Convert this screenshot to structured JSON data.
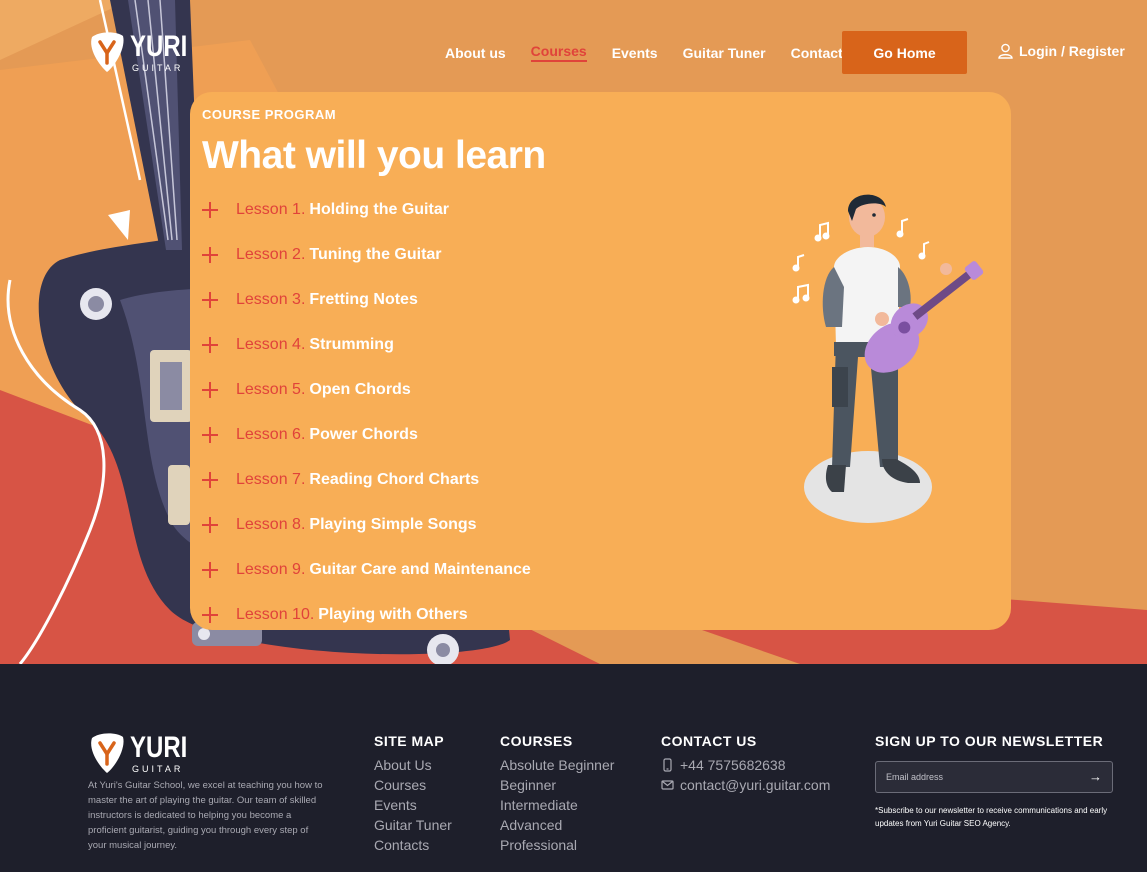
{
  "brand": {
    "name": "YURI",
    "tagline": "GUITAR"
  },
  "nav": {
    "items": [
      "About us",
      "Courses",
      "Events",
      "Guitar Tuner",
      "Contacts"
    ],
    "active": "Courses",
    "cta": "Go Home",
    "login": "Login / Register"
  },
  "program": {
    "eyebrow": "COURSE PROGRAM",
    "heading": "What will you learn",
    "lessons": [
      {
        "num": "Lesson 1.",
        "title": "Holding the Guitar"
      },
      {
        "num": "Lesson 2.",
        "title": "Tuning the Guitar"
      },
      {
        "num": "Lesson 3.",
        "title": "Fretting Notes"
      },
      {
        "num": "Lesson 4.",
        "title": "Strumming"
      },
      {
        "num": "Lesson 5.",
        "title": "Open Chords"
      },
      {
        "num": "Lesson 6.",
        "title": "Power Chords"
      },
      {
        "num": "Lesson 7.",
        "title": "Reading Chord Charts"
      },
      {
        "num": "Lesson 8.",
        "title": "Playing Simple Songs"
      },
      {
        "num": "Lesson 9.",
        "title": "Guitar Care and Maintenance"
      },
      {
        "num": "Lesson 10.",
        "title": "Playing with Others"
      }
    ]
  },
  "footer": {
    "about": "At Yuri's Guitar School, we excel at teaching you how to master the art of playing the guitar. Our team of skilled instructors is dedicated to helping you become a proficient guitarist, guiding you through every step of your musical journey.",
    "sitemap": {
      "heading": "SITE MAP",
      "items": [
        "About Us",
        "Courses",
        "Events",
        "Guitar Tuner",
        "Contacts"
      ]
    },
    "courses": {
      "heading": "COURSES",
      "items": [
        "Absolute Beginner",
        "Beginner",
        "Intermediate",
        "Advanced",
        "Professional"
      ]
    },
    "contact": {
      "heading": "CONTACT US",
      "phone": "+44 7575682638",
      "email": "contact@yuri.guitar.com"
    },
    "newsletter": {
      "heading": "SIGN UP TO OUR NEWSLETTER",
      "placeholder": "Email address",
      "note": "*Subscribe to our newsletter to receive communications and early updates from Yuri Guitar SEO Agency."
    }
  },
  "colors": {
    "hero_bg": "#e49a55",
    "panel": "#f8ae56",
    "accent": "#e0433a",
    "cta": "#d8641a",
    "footer": "#1e1f2b"
  }
}
